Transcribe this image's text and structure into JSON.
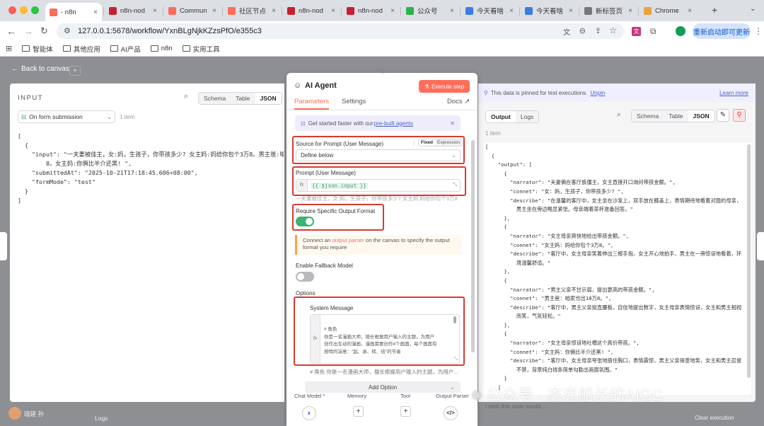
{
  "browser": {
    "tabs": [
      {
        "label": "- n8n",
        "fav": "#ff6d5a"
      },
      {
        "label": "n8n-nod",
        "fav": "#c8202f"
      },
      {
        "label": "Commun",
        "fav": "#ff6d5a"
      },
      {
        "label": "社区节点",
        "fav": "#ff6d5a"
      },
      {
        "label": "n8n-nod",
        "fav": "#c8202f"
      },
      {
        "label": "n8n-nod",
        "fav": "#c8202f"
      },
      {
        "label": "公众号",
        "fav": "#2bb24c"
      },
      {
        "label": "今天看啥",
        "fav": "#3d7be8"
      },
      {
        "label": "今天看啥",
        "fav": "#3d7be8"
      },
      {
        "label": "新标签页",
        "fav": "#777777"
      },
      {
        "label": "Chrome",
        "fav": "#e8a33d"
      }
    ],
    "url": "127.0.0.1:5678/workflow/YxnBLgNjkKZzsPfO/e355c3",
    "relaunch": "重新启动即可更新",
    "bookmarks": [
      "智能体",
      "其他应用",
      "AI产品",
      "n8n",
      "实用工具"
    ]
  },
  "canvas": {
    "back": "Back to canvas",
    "user": "瑞建 孙",
    "logs": "Logs",
    "clear": "Clear execution"
  },
  "input_panel": {
    "title": "INPUT",
    "views": [
      "Schema",
      "Table",
      "JSON"
    ],
    "source": "On form submission",
    "count": "1 item",
    "json_lines": [
      "[",
      "  {",
      "    \"input\": \"一夫妻被佳主，女:妈，生孩子，你带孩多少? 女主妈:妈给你包个3万8。男主爸:咱家也出18万",
      "        8。女主妈:你俩比半介还黑! \",",
      "    \"submittedAt\": \"2025-10-21T17:18:45.606+08:00\",",
      "    \"formMode\": \"test\"",
      "  }",
      "]"
    ]
  },
  "agent": {
    "title": "AI Agent",
    "execute": "Execute step",
    "tabs": [
      "Parameters",
      "Settings"
    ],
    "docs": "Docs",
    "banner_pre": "Get started faster with our ",
    "banner_link": "pre-built agents",
    "source_label": "Source for Prompt (User Message)",
    "fixed": "Fixed",
    "expression": "Expression",
    "source_value": "Define below",
    "prompt_label": "Prompt (User Message)",
    "prompt_value": "{{ $json.input }}",
    "prompt_preview": "一夫妻被佳主，女:妈，生孩子，你带孩多少? 女主妈:妈给你包个3万8",
    "require_label": "Require Specific Output Format",
    "parser_pre": "Connect an ",
    "parser_link": "output parser",
    "parser_post": " on the canvas to specify the output format you require",
    "fallback_label": "Enable Fallback Model",
    "options_label": "Options",
    "sysmsg_label": "System Message",
    "sysmsg_lines": [
      "# 角色",
      "你是一名漫画大师，擅长根据用户输入的主题，为用户",
      "创作出生动的漫画，漫画需要创作4个画面，每个画面有",
      "按特的演意：\"起、承、转、结\"的节奏"
    ],
    "sysmsg_preview": "# 角色 你是一名漫画大师，擅长根据用户输入的主题，为用户...",
    "add_option": "Add Option",
    "subnodes": [
      "Chat Model *",
      "Memory",
      "Tool",
      "Output Parser"
    ]
  },
  "output_panel": {
    "pinned": "This data is pinned for test executions.",
    "unpin": "Unpin",
    "learn": "Learn more",
    "tabs": [
      "Output",
      "Logs"
    ],
    "views": [
      "Schema",
      "Table",
      "JSON"
    ],
    "count": "1 item",
    "json_lines": [
      "[",
      "  {",
      "    \"output\": [",
      "      {",
      "        \"narrator\": \"夫妻俩在客厅族僵主，女主直接开口询问带孩金额。\",",
      "        \"connet\": \"女：妈，生孩子，你带孩多少? \",",
      "        \"describe\": \"在温馨的客厅中，女主坐在沙发上，双手放在膝盖上，表情期待地看着对面的母亲，",
      "          男主坐在旁边略显紧张。母亲端着茶杯准备回答。\"",
      "      },",
      "      {",
      "        \"narrator\": \"女主母亲爽快地给出带孩金额。\",",
      "        \"connet\": \"女主妈：妈给你包个3万8。\",",
      "        \"describe\": \"客厅中，女主母亲笑着伸出三根手指，女主开心地拍手，男主在一旁惊讶地看着，环",
      "          境温馨舒适。\"",
      "      },",
      "      {",
      "        \"narrator\": \"男主父亲不甘示弱，提出更高的带孩金额。\",",
      "        \"connet\": \"男主爸：咱家也出18万8。\",",
      "        \"describe\": \"客厅中，男主父亲挺直腰板，自信地提出数字，女主母亲表情惊讶，女主和男主相视",
      "          而笑，气氛轻松。\"",
      "      },",
      "      {",
      "        \"narrator\": \"女主母亲惊讶地吐槽这个高价带孩。\",",
      "        \"connet\": \"女主妈：你俩比半介还黑! \",",
      "        \"describe\": \"客厅中，女主母亲夸张地捂住胸口，表情震惊，男主父亲得意地笑，女主和男主忍俊",
      "          不禁，背景纯白线条简单勾勒出画面氛围。\"",
      "      }",
      "    ]",
      "  }",
      "]"
    ],
    "feedback": "I wish this node would..."
  },
  "watermark": "公众号 · 杰克船长的AIGC"
}
